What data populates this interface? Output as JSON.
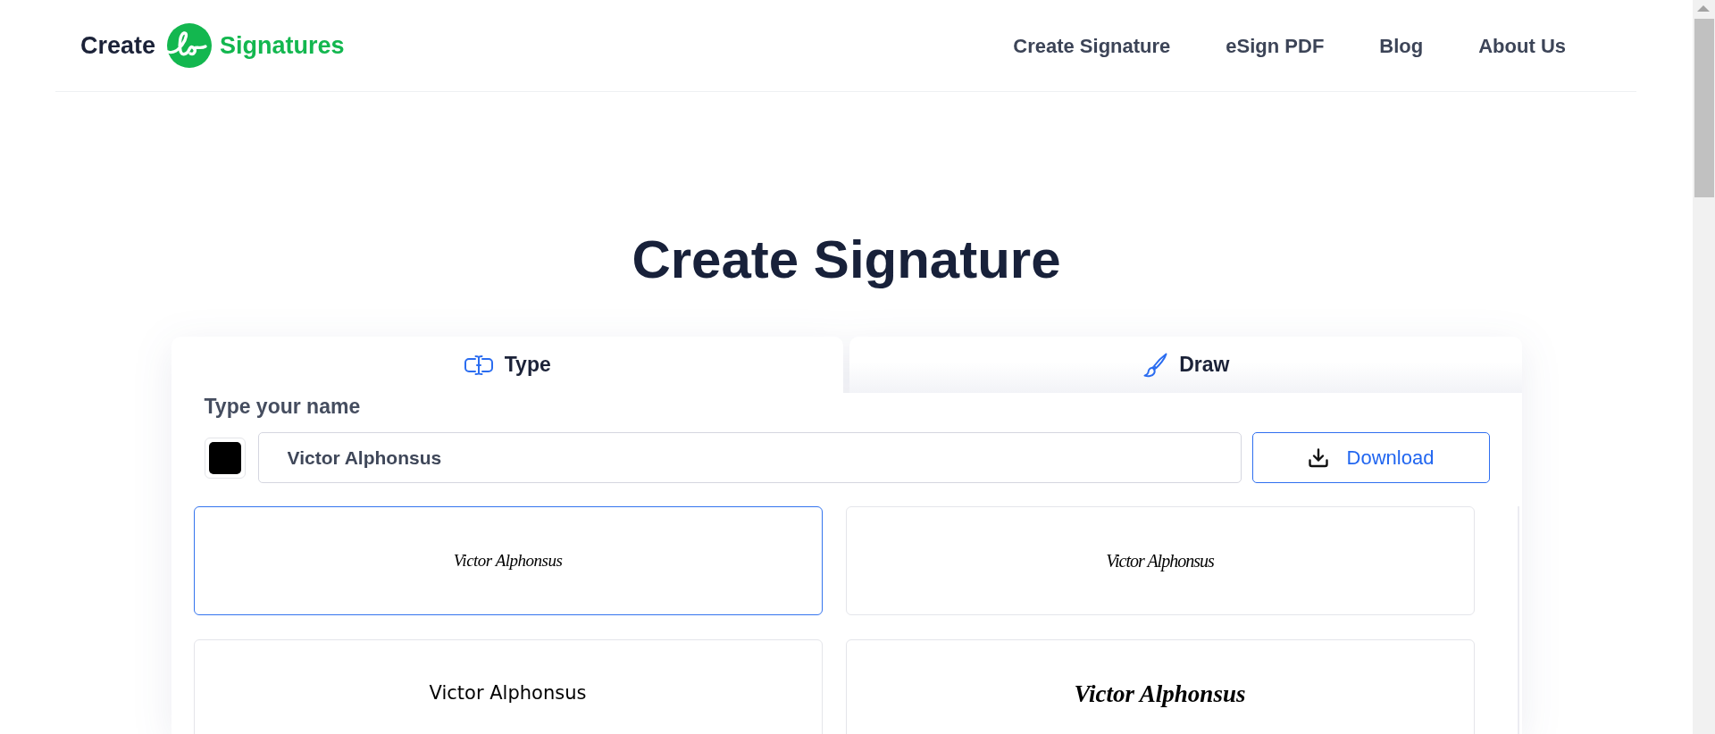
{
  "header": {
    "logo": {
      "left": "Create",
      "right": "Signatures"
    },
    "nav": [
      "Create Signature",
      "eSign PDF",
      "Blog",
      "About Us"
    ]
  },
  "title": "Create Signature",
  "tabs": [
    {
      "label": "Type",
      "kind": "type",
      "selected": true
    },
    {
      "label": "Draw",
      "kind": "draw",
      "selected": false
    }
  ],
  "type_panel": {
    "label": "Type your name",
    "color_picker": {
      "color": "#000000"
    },
    "name_value": "Victor Alphonsus",
    "download_label": "Download"
  },
  "signatures": [
    {
      "text": "Victor Alphonsus",
      "kind": "thin-script",
      "selected": true
    },
    {
      "text": "Victor Alphonsus",
      "kind": "tall-script",
      "selected": false
    },
    {
      "text": "Victor Alphonsus",
      "kind": "hand",
      "selected": false
    },
    {
      "text": "Victor Alphonsus",
      "kind": "bold-italic",
      "selected": false
    }
  ]
}
